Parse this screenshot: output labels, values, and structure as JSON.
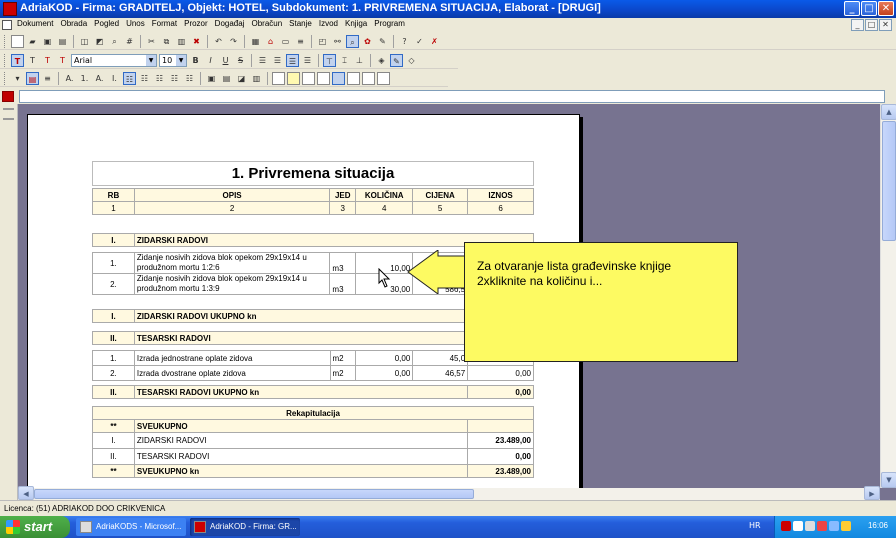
{
  "window": {
    "title": "AdriaKOD - Firma: GRADITELJ,  Objekt: HOTEL,  Subdokument: 1. PRIVREMENA SITUACIJA,  Elaborat - [DRUGI]",
    "min": "_",
    "max": "□",
    "close": "✕"
  },
  "menu": {
    "items": [
      "Dokument",
      "Obrada",
      "Pogled",
      "Unos",
      "Format",
      "Prozor",
      "Događaj",
      "Obračun",
      "Stanje",
      "Izvod",
      "Knjiga",
      "Program"
    ],
    "mdi_min": "_",
    "mdi_max": "□",
    "mdi_close": "✕"
  },
  "toolbar": {
    "font_name": "Arial",
    "font_size": "10",
    "bold": "B",
    "italic": "I",
    "underline": "U",
    "strike": "S",
    "t_buttons": [
      "T",
      "T",
      "T",
      "T"
    ],
    "numbering": [
      "A.",
      "1.",
      "A.",
      "I."
    ]
  },
  "document": {
    "title": "1. Privremena situacija",
    "headers": {
      "rb": "RB",
      "opis": "OPIS",
      "jed": "JED",
      "kolicina": "KOLIČINA",
      "cijena": "CIJENA",
      "iznos": "IZNOS"
    },
    "colnums": [
      "1",
      "2",
      "3",
      "4",
      "5",
      "6"
    ],
    "sections": [
      {
        "rb": "I.",
        "name": "ZIDARSKI RADOVI",
        "rows": [
          {
            "rb": "1.",
            "opis": "Zidanje nosivih zidova blok opekom 29x19x14 u produžnom mortu 1:2:6",
            "jed": "m3",
            "kolicina": "10,00",
            "cijena": "",
            "iznos": ""
          },
          {
            "rb": "2.",
            "opis": "Zidanje nosivih zidova blok opekom 29x19x14 u produžnom mortu 1:3:9",
            "jed": "m3",
            "kolicina": "30,00",
            "cijena": "586,5",
            "iznos": ""
          }
        ],
        "total_rb": "I.",
        "total_label": "ZIDARSKI RADOVI UKUPNO kn",
        "total": ""
      },
      {
        "rb": "II.",
        "name": "TESARSKI RADOVI",
        "rows": [
          {
            "rb": "1.",
            "opis": "Izrada jednostrane oplate zidova",
            "jed": "m2",
            "kolicina": "0,00",
            "cijena": "45,0",
            "iznos": ""
          },
          {
            "rb": "2.",
            "opis": "Izrada dvostrane oplate zidova",
            "jed": "m2",
            "kolicina": "0,00",
            "cijena": "46,57",
            "iznos": "0,00"
          }
        ],
        "total_rb": "II.",
        "total_label": "TESARSKI RADOVI UKUPNO kn",
        "total": "0,00"
      }
    ],
    "recap": {
      "title": "Rekapitulacija",
      "rows": [
        {
          "rb": "**",
          "label": "SVEUKUPNO",
          "value": "",
          "bold": true
        },
        {
          "rb": "I.",
          "label": "ZIDARSKI RADOVI",
          "value": "23.489,00",
          "bold": false
        },
        {
          "rb": "II.",
          "label": "TESARSKI RADOVI",
          "value": "0,00",
          "bold": false
        },
        {
          "rb": "**",
          "label": "SVEUKUPNO kn",
          "value": "23.489,00",
          "bold": true
        }
      ]
    }
  },
  "callout": {
    "text": "Za otvaranje lista građevinske knjige\n2xkliknite na količinu i..."
  },
  "status": {
    "licence": "Licenca: (51) ADRIAKOD DOO CRIKVENICA"
  },
  "taskbar": {
    "start": "start",
    "tasks": [
      "AdriaKODS - Microsof...",
      "AdriaKOD - Firma: GR..."
    ],
    "lang": "HR",
    "clock": "16:06"
  },
  "colors": {
    "accent": "#0b46c8",
    "callout": "#fdfa62",
    "workspace": "#777390",
    "header_fill": "#fff9e0"
  }
}
